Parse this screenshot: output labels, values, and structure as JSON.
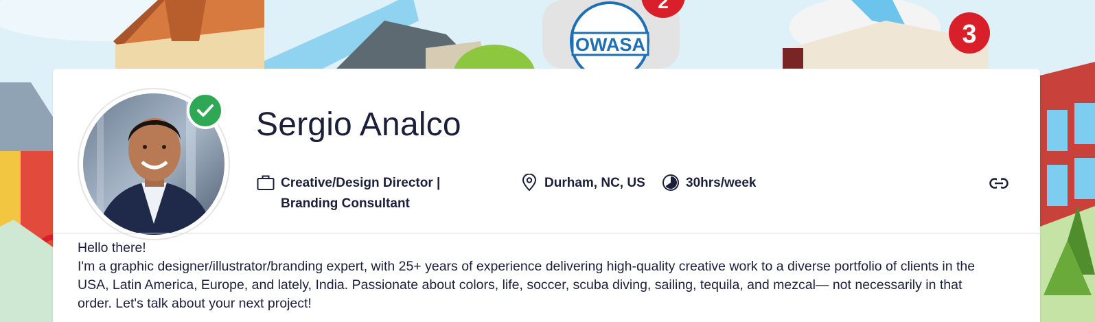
{
  "banner": {
    "badge_left": "OWASA",
    "step_two": "2",
    "step_three": "3"
  },
  "profile": {
    "name": "Sergio Analco",
    "verified": true,
    "role_line_1": "Creative/Design Director |",
    "role_line_2": "Branding Consultant",
    "location": "Durham, NC, US",
    "availability": "30hrs/week"
  },
  "bio": {
    "greeting": "Hello there!",
    "text": "I'm a graphic designer/illustrator/branding expert, with 25+ years of experience delivering high-quality creative work to a diverse portfolio of clients in the USA, Latin America, Europe, and lately, India. Passionate about colors, life, soccer, scuba diving, sailing, tequila, and mezcal— not necessarily in that order. Let's talk about your next project!"
  },
  "icons": {
    "role": "briefcase-icon",
    "location": "map-pin-icon",
    "availability": "clock-pie-icon",
    "share": "link-icon",
    "verified": "checkmark-icon"
  },
  "colors": {
    "text": "#1b1f3a",
    "verified_green": "#2fa855",
    "banner_sky": "#dff1f8",
    "badge_red": "#d91f2a",
    "owasa_blue": "#1f6fb5"
  }
}
